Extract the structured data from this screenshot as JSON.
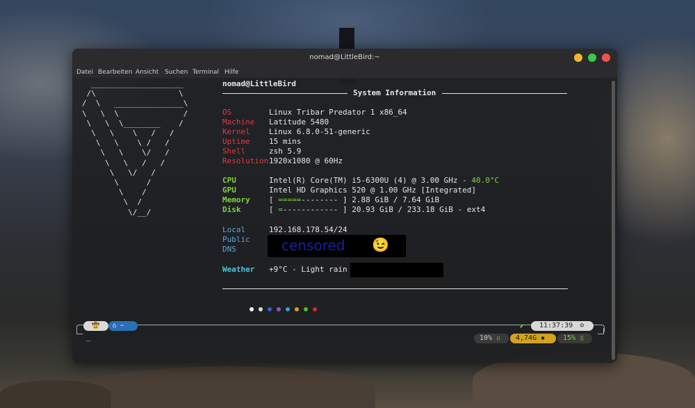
{
  "window": {
    "title": "nomad@LittleBird:~"
  },
  "menu": [
    "Datei",
    "Bearbeiten",
    "Ansicht",
    "Suchen",
    "Terminal",
    "Hilfe"
  ],
  "ascii_logo": "  ____________________\n /\\                  \\\n/  \\   _______________\\\n\\   \\  \\              /\n \\   \\  \\________    /\n  \\   \\    \\   /   /\n   \\   \\    \\ /   /\n    \\   \\    \\/   /\n     \\   \\   /   /\n      \\   \\/   /\n       \\      /\n        \\    /\n         \\  /\n          \\/__/",
  "fetch": {
    "user_host": "nomad@LittleBird",
    "section_title": "System Information",
    "rows": [
      {
        "label": "OS",
        "value": "Linux Tribar Predator 1 x86_64"
      },
      {
        "label": "Machine",
        "value": "Latitude 5480"
      },
      {
        "label": "Kernel",
        "value": "Linux 6.8.0-51-generic"
      },
      {
        "label": "Uptime",
        "value": "15 mins"
      },
      {
        "label": "Shell",
        "value": "zsh 5.9"
      },
      {
        "label": "Resolution",
        "value": "1920x1080 @ 60Hz"
      }
    ],
    "hardware": [
      {
        "label": "CPU",
        "value": "Intel(R) Core(TM) i5-6300U (4) @ 3.00 GHz - ",
        "extra": "40.0°C"
      },
      {
        "label": "GPU",
        "value": "Intel HD Graphics 520 @ 1.00 GHz [Integrated]"
      },
      {
        "label": "Memory",
        "bar_fill": "=====",
        "bar_empty": "--------",
        "value": "2.88 GiB / 7.64 GiB"
      },
      {
        "label": "Disk",
        "bar_fill": "=",
        "bar_empty": "------------",
        "value": "20.93 GiB / 233.18 GiB - ext4"
      }
    ],
    "network": [
      {
        "label": "Local",
        "value": "192.168.178.54/24"
      },
      {
        "label": "Public",
        "value": ""
      },
      {
        "label": "DNS",
        "value": ""
      }
    ],
    "censor_text": "censored",
    "censor_emoji": "😉",
    "weather": {
      "label": "Weather",
      "value": "+9°C - Light rain"
    },
    "color_dots": [
      "#ffffff",
      "#dcdcdc",
      "#3b5fd1",
      "#8a56c2",
      "#3aa0c8",
      "#d3a21f",
      "#4fbf2c",
      "#d42a2a"
    ]
  },
  "prompt": {
    "user_icon": "🤠",
    "dir_icon": "home-icon",
    "dir": "~",
    "check": "✔",
    "time": "11:37:39",
    "cursor": "_",
    "cpu": "10%",
    "memory": "4,74G",
    "battery": "15%"
  }
}
